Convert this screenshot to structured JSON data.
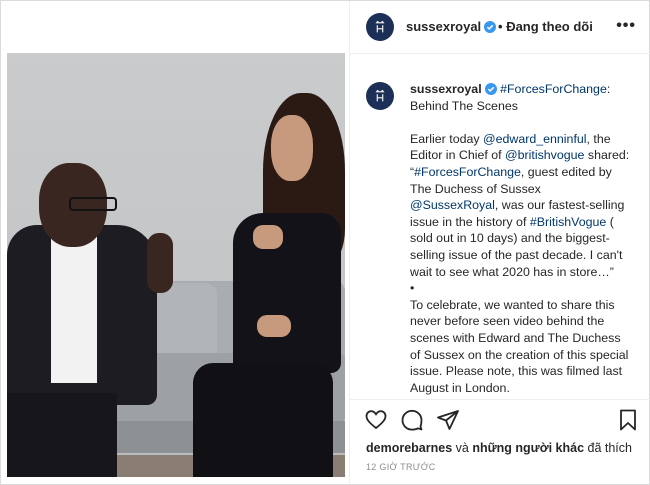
{
  "header": {
    "username": "sussexroyal",
    "separator": "•",
    "follow_status": "Đang theo dõi",
    "more": "•••"
  },
  "caption": {
    "username": "sussexroyal",
    "hashtag_title": "#ForcesForChange",
    "title_rest": ":",
    "subtitle": "Behind The Scenes",
    "p1": [
      {
        "t": "Earlier today ",
        "tag": false
      },
      {
        "t": "@edward_enninful",
        "tag": true
      },
      {
        "t": ", the Editor in Chief of ",
        "tag": false
      },
      {
        "t": "@britishvogue",
        "tag": true
      },
      {
        "t": " shared: “",
        "tag": false
      },
      {
        "t": "#ForcesForChange",
        "tag": true
      },
      {
        "t": ", guest edited by The Duchess of Sussex ",
        "tag": false
      },
      {
        "t": "@SussexRoyal",
        "tag": true
      },
      {
        "t": ", was our fastest-selling issue in the history of ",
        "tag": false
      },
      {
        "t": "#BritishVogue",
        "tag": true
      },
      {
        "t": " ( sold out in 10 days) and the biggest-selling issue of the past decade. I can't wait to see what 2020 has in store…”",
        "tag": false
      }
    ],
    "bullet": "•",
    "p2": "To celebrate, we wanted to share this never before seen video behind the scenes with Edward and The Duchess of Sussex on the creation of this special issue. Please note, this was filmed last August in London."
  },
  "likes": {
    "user": "demorebarnes",
    "connector": " và ",
    "others": "những người khác",
    "suffix": " đã thích"
  },
  "timestamp": "12 GIỜ TRƯỚC",
  "icons": [
    "heart-icon",
    "comment-icon",
    "share-icon",
    "bookmark-icon",
    "verified-icon",
    "more-options-icon"
  ],
  "colors": {
    "link": "#00376b",
    "verified": "#3897f0",
    "avatar_bg": "#1c2f56"
  }
}
